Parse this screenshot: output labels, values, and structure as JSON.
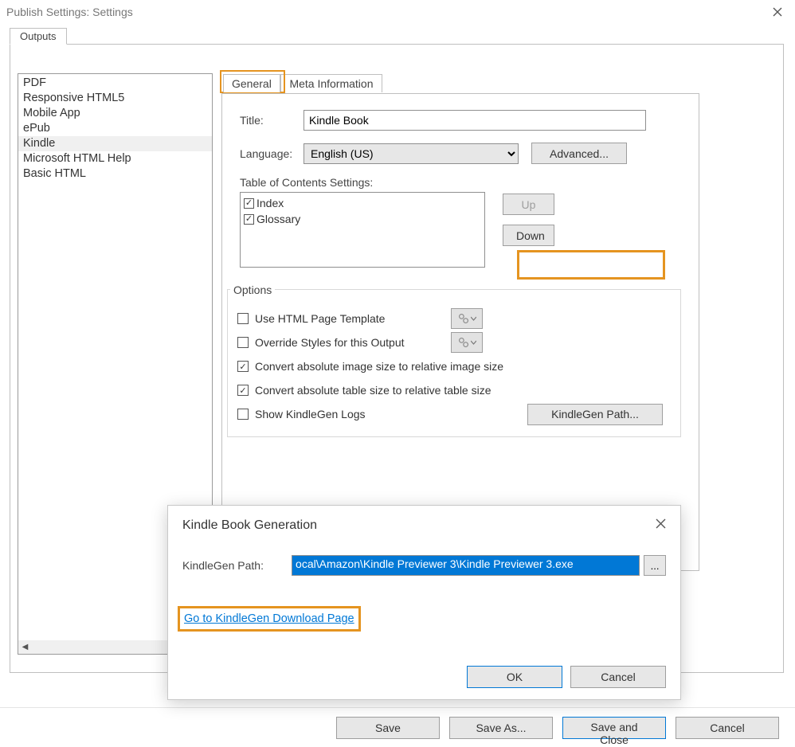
{
  "window": {
    "title": "Publish Settings: Settings"
  },
  "outputsTab": {
    "label": "Outputs"
  },
  "outputs": {
    "items": [
      {
        "label": "PDF"
      },
      {
        "label": "Responsive HTML5"
      },
      {
        "label": "Mobile App"
      },
      {
        "label": "ePub"
      },
      {
        "label": "Kindle"
      },
      {
        "label": "Microsoft HTML Help"
      },
      {
        "label": "Basic HTML"
      }
    ],
    "selected": "Kindle"
  },
  "tabs": {
    "general": "General",
    "meta": "Meta Information"
  },
  "general": {
    "titleLabel": "Title:",
    "titleValue": "Kindle Book",
    "languageLabel": "Language:",
    "languageValue": "English (US)",
    "advancedBtn": "Advanced...",
    "tocLabel": "Table of Contents Settings:",
    "toc": {
      "items": [
        {
          "label": "Index",
          "checked": true
        },
        {
          "label": "Glossary",
          "checked": true
        }
      ],
      "upBtn": "Up",
      "downBtn": "Down"
    },
    "optionsLabel": "Options",
    "options": {
      "useTemplate": {
        "label": "Use HTML Page Template",
        "checked": false
      },
      "overrideStyles": {
        "label": "Override Styles for this Output",
        "checked": false
      },
      "convImage": {
        "label": "Convert absolute image size to relative image size",
        "checked": true
      },
      "convTable": {
        "label": "Convert absolute table size to relative table size",
        "checked": true
      },
      "showLogs": {
        "label": "Show KindleGen Logs",
        "checked": false
      },
      "kgenBtn": "KindleGen Path..."
    }
  },
  "modal": {
    "title": "Kindle Book Generation",
    "pathLabel": "KindleGen Path:",
    "pathValue": "ocal\\Amazon\\Kindle Previewer 3\\Kindle Previewer 3.exe",
    "browse": "...",
    "link": "Go to KindleGen Download Page",
    "ok": "OK",
    "cancel": "Cancel"
  },
  "footer": {
    "save": "Save",
    "saveAs": "Save As...",
    "saveClose": "Save and Close",
    "cancel": "Cancel"
  }
}
